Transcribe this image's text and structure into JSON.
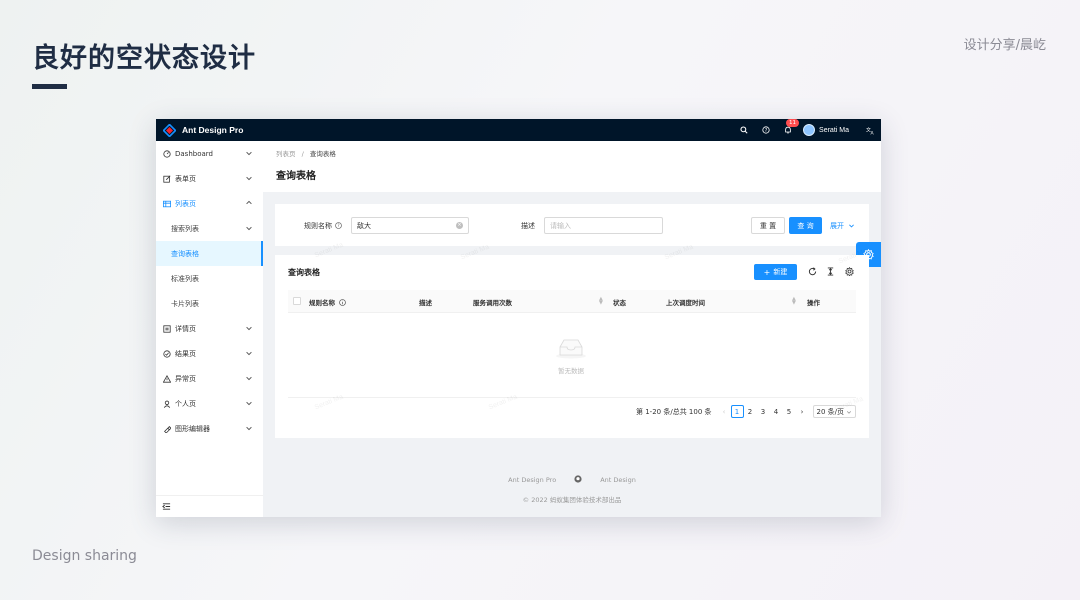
{
  "slide": {
    "title": "良好的空状态设计",
    "tag": "设计分享/晨屹",
    "footer": "Design sharing"
  },
  "header": {
    "app_name": "Ant Design Pro",
    "notification_count": "11",
    "user_name": "Serati Ma",
    "icons": [
      "search-icon",
      "question-icon",
      "bell-icon",
      "translate-icon"
    ]
  },
  "sidebar": {
    "items": [
      {
        "label": "Dashboard",
        "icon": "dashboard-icon"
      },
      {
        "label": "表单页",
        "icon": "form-icon"
      },
      {
        "label": "列表页",
        "icon": "table-icon"
      },
      {
        "label": "搜索列表"
      },
      {
        "label": "查询表格"
      },
      {
        "label": "标准列表"
      },
      {
        "label": "卡片列表"
      },
      {
        "label": "详情页",
        "icon": "profile-icon"
      },
      {
        "label": "结果页",
        "icon": "check-circle-icon"
      },
      {
        "label": "异常页",
        "icon": "warning-icon"
      },
      {
        "label": "个人页",
        "icon": "user-icon"
      },
      {
        "label": "图形编辑器",
        "icon": "highlight-icon"
      }
    ]
  },
  "breadcrumb": {
    "parent": "列表页",
    "separator": "/",
    "current": "查询表格"
  },
  "page": {
    "title": "查询表格"
  },
  "search_form": {
    "rule_label": "规则名称",
    "rule_value": "敌大",
    "desc_label": "描述",
    "desc_placeholder": "请输入",
    "reset": "重 置",
    "query": "查 询",
    "expand": "展开"
  },
  "table": {
    "title": "查询表格",
    "new_button": "新建",
    "columns": [
      "规则名称",
      "描述",
      "服务调用次数",
      "状态",
      "上次调度时间",
      "操作"
    ],
    "empty_text": "暂无数据"
  },
  "pagination": {
    "summary": "第 1-20 条/总共 100 条",
    "pages": [
      "1",
      "2",
      "3",
      "4",
      "5"
    ],
    "current": "1",
    "page_size": "20 条/页"
  },
  "footer": {
    "links": [
      "Ant Design Pro",
      "Ant Design"
    ],
    "copyright": "2022 蚂蚁集团体验技术部出品"
  },
  "watermark": "Serati Ma",
  "colors": {
    "primary": "#1890ff",
    "header_bg": "#001529",
    "slide_title": "#1f2d44",
    "badge": "#ff4d4f"
  }
}
